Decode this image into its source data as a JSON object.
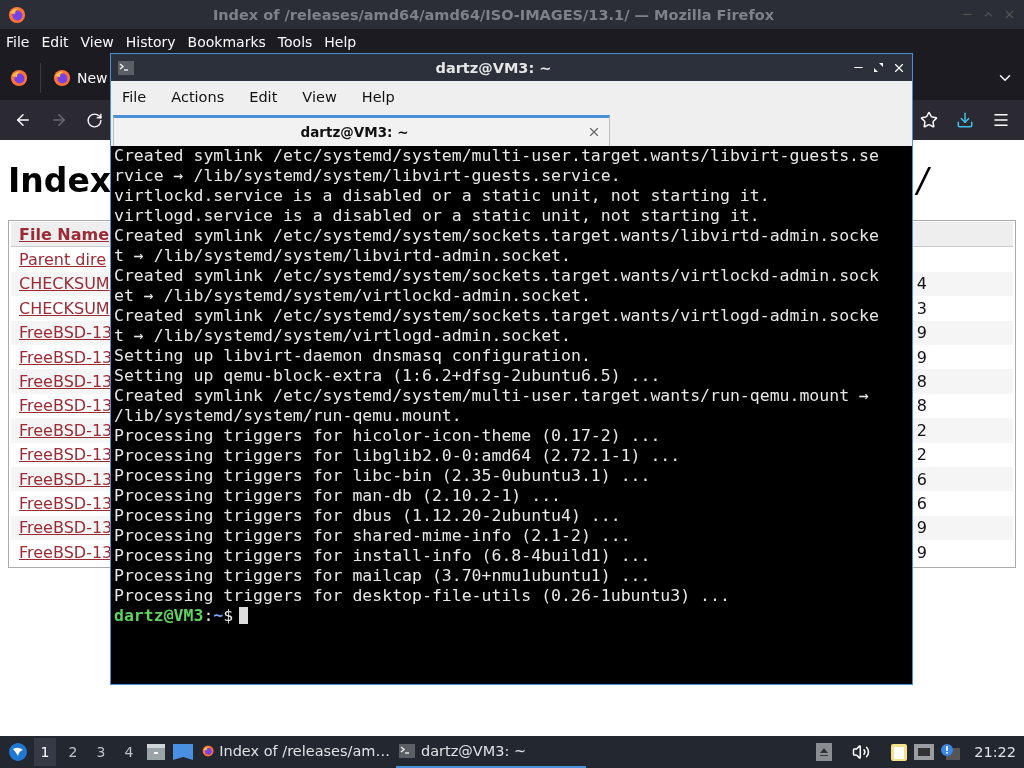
{
  "browser": {
    "title": "Index of /releases/amd64/amd64/ISO-IMAGES/13.1/ — Mozilla Firefox",
    "menu": [
      "File",
      "Edit",
      "View",
      "History",
      "Bookmarks",
      "Tools",
      "Help"
    ],
    "tab": {
      "label": "New"
    },
    "forward_disabled": true,
    "page": {
      "heading_start": "Index",
      "heading_end": "/",
      "header": "File Name",
      "rows": [
        {
          "file_name": "Parent dire"
        },
        {
          "file_name": "CHECKSUM",
          "last_column": "4"
        },
        {
          "file_name": "CHECKSUM",
          "last_column": "3"
        },
        {
          "file_name": "FreeBSD-13",
          "last_column": "9"
        },
        {
          "file_name": "FreeBSD-13",
          "last_column": "9"
        },
        {
          "file_name": "FreeBSD-13",
          "last_column": "8"
        },
        {
          "file_name": "FreeBSD-13",
          "last_column": "8"
        },
        {
          "file_name": "FreeBSD-13",
          "last_column": "2"
        },
        {
          "file_name": "FreeBSD-13",
          "last_column": "2"
        },
        {
          "file_name": "FreeBSD-13",
          "last_column": "6"
        },
        {
          "file_name": "FreeBSD-13",
          "last_column": "6"
        },
        {
          "file_name": "FreeBSD-13",
          "last_column": "9"
        },
        {
          "file_name": "FreeBSD-13",
          "last_column": "9"
        }
      ]
    }
  },
  "terminal": {
    "title": "dartz@VM3: ~",
    "menu": [
      "File",
      "Actions",
      "Edit",
      "View",
      "Help"
    ],
    "tab": {
      "label": "dartz@VM3: ~",
      "selected": true
    },
    "lines": [
      "Created symlink /etc/systemd/system/multi-user.target.wants/libvirt-guests.se",
      "rvice → /lib/systemd/system/libvirt-guests.service.",
      "virtlockd.service is a disabled or a static unit, not starting it.",
      "virtlogd.service is a disabled or a static unit, not starting it.",
      "Created symlink /etc/systemd/system/sockets.target.wants/libvirtd-admin.socke",
      "t → /lib/systemd/system/libvirtd-admin.socket.",
      "Created symlink /etc/systemd/system/sockets.target.wants/virtlockd-admin.sock",
      "et → /lib/systemd/system/virtlockd-admin.socket.",
      "Created symlink /etc/systemd/system/sockets.target.wants/virtlogd-admin.socke",
      "t → /lib/systemd/system/virtlogd-admin.socket.",
      "Setting up libvirt-daemon dnsmasq configuration.",
      "Setting up qemu-block-extra (1:6.2+dfsg-2ubuntu6.5) ...",
      "Created symlink /etc/systemd/system/multi-user.target.wants/run-qemu.mount →",
      "/lib/systemd/system/run-qemu.mount.",
      "Processing triggers for hicolor-icon-theme (0.17-2) ...",
      "Processing triggers for libglib2.0-0:amd64 (2.72.1-1) ...",
      "Processing triggers for libc-bin (2.35-0ubuntu3.1) ...",
      "Processing triggers for man-db (2.10.2-1) ...",
      "Processing triggers for dbus (1.12.20-2ubuntu4) ...",
      "Processing triggers for shared-mime-info (2.1-2) ...",
      "Processing triggers for install-info (6.8-4build1) ...",
      "Processing triggers for mailcap (3.70+nmu1ubuntu1) ...",
      "Processing triggers for desktop-file-utils (0.26-1ubuntu3) ..."
    ],
    "prompt": {
      "user_host": "dartz@VM3",
      "separator": ":",
      "path": "~",
      "symbol": "$"
    }
  },
  "taskbar": {
    "workspaces": [
      {
        "label": "1",
        "selected": true
      },
      {
        "label": "2",
        "selected": false
      },
      {
        "label": "3",
        "selected": false
      },
      {
        "label": "4",
        "selected": false
      }
    ],
    "tasks": [
      {
        "kind": "browser",
        "label": "Index of /releases/am…",
        "selected": false
      },
      {
        "kind": "terminal",
        "label": "dartz@VM3: ~",
        "selected": true
      }
    ],
    "clock": "21:22"
  }
}
